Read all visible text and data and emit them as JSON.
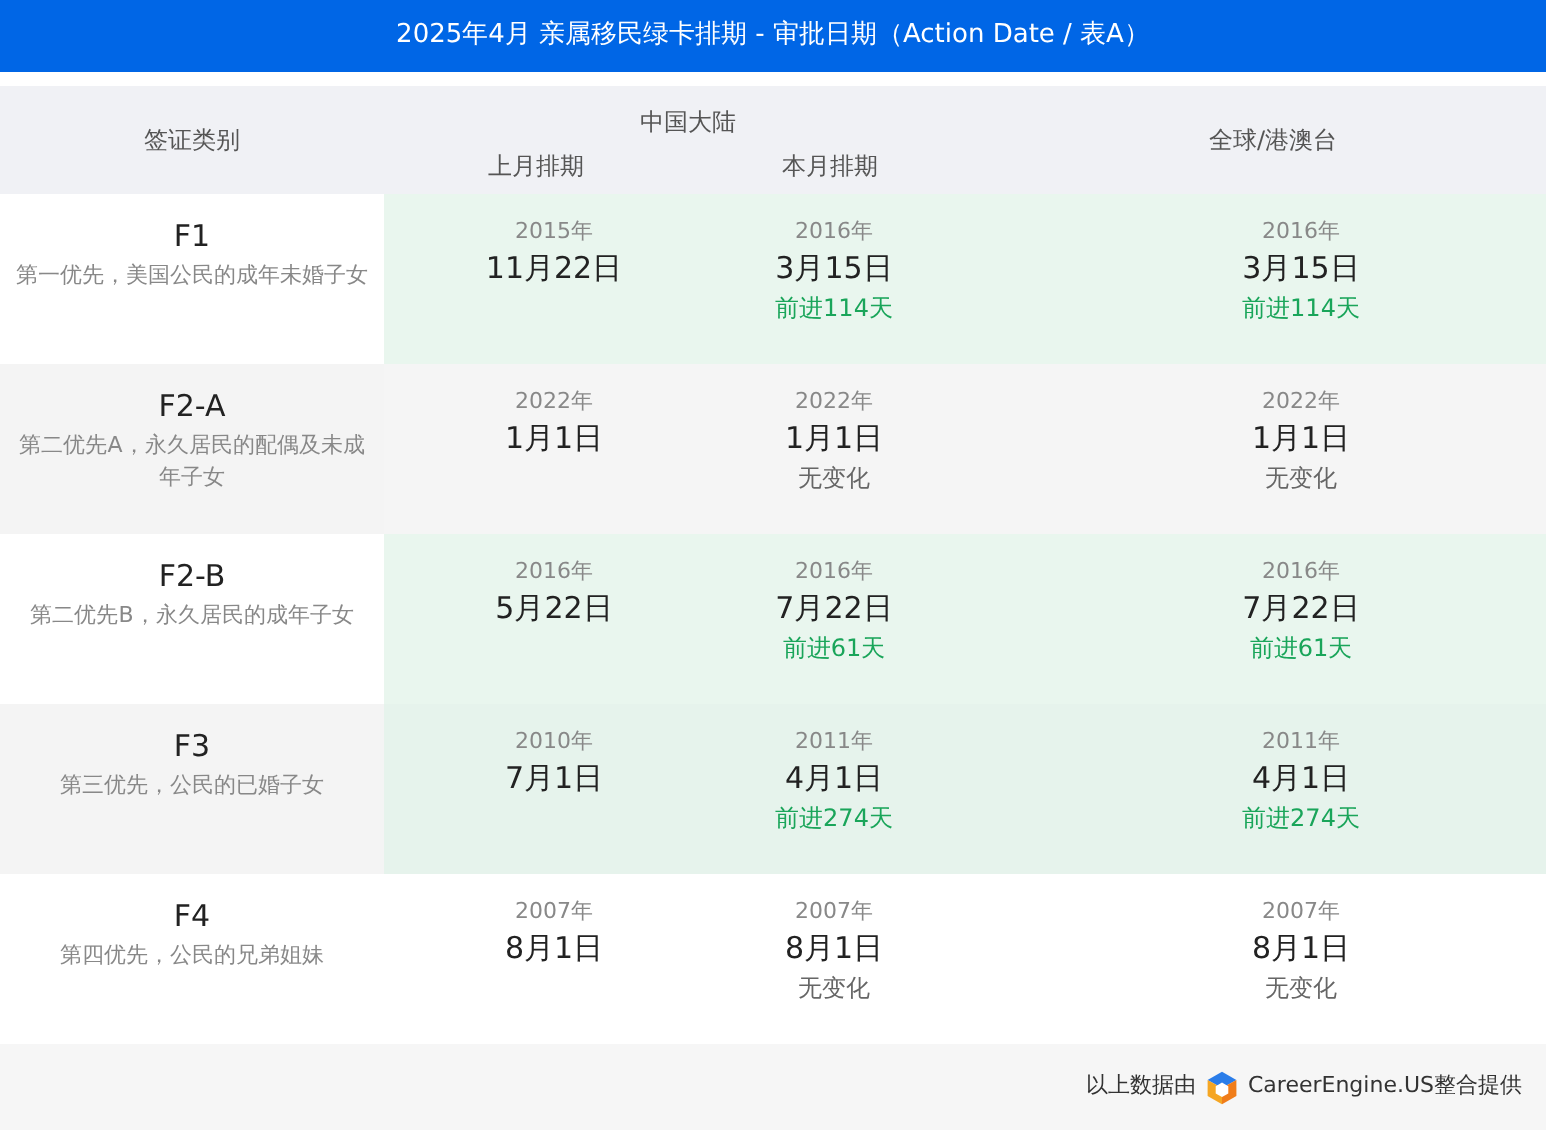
{
  "title": "2025年4月 亲属移民绿卡排期 - 审批日期（Action Date / 表A）",
  "header": {
    "category": "签证类别",
    "china_group": "中国大陆",
    "china_last": "上月排期",
    "china_this": "本月排期",
    "global": "全球/港澳台"
  },
  "rows": [
    {
      "code": "F1",
      "desc": "第一优先，美国公民的成年未婚子女",
      "advanced": true,
      "cn_last": {
        "year": "2015年",
        "date": "11月22日"
      },
      "cn_this": {
        "year": "2016年",
        "date": "3月15日",
        "change": "前进114天"
      },
      "global": {
        "year": "2016年",
        "date": "3月15日",
        "change": "前进114天"
      }
    },
    {
      "code": "F2-A",
      "desc": "第二优先A，永久居民的配偶及未成年子女",
      "advanced": false,
      "cn_last": {
        "year": "2022年",
        "date": "1月1日"
      },
      "cn_this": {
        "year": "2022年",
        "date": "1月1日",
        "change": "无变化"
      },
      "global": {
        "year": "2022年",
        "date": "1月1日",
        "change": "无变化"
      }
    },
    {
      "code": "F2-B",
      "desc": "第二优先B，永久居民的成年子女",
      "advanced": true,
      "cn_last": {
        "year": "2016年",
        "date": "5月22日"
      },
      "cn_this": {
        "year": "2016年",
        "date": "7月22日",
        "change": "前进61天"
      },
      "global": {
        "year": "2016年",
        "date": "7月22日",
        "change": "前进61天"
      }
    },
    {
      "code": "F3",
      "desc": "第三优先，公民的已婚子女",
      "advanced": true,
      "cn_last": {
        "year": "2010年",
        "date": "7月1日"
      },
      "cn_this": {
        "year": "2011年",
        "date": "4月1日",
        "change": "前进274天"
      },
      "global": {
        "year": "2011年",
        "date": "4月1日",
        "change": "前进274天"
      }
    },
    {
      "code": "F4",
      "desc": "第四优先，公民的兄弟姐妹",
      "advanced": false,
      "cn_last": {
        "year": "2007年",
        "date": "8月1日"
      },
      "cn_this": {
        "year": "2007年",
        "date": "8月1日",
        "change": "无变化"
      },
      "global": {
        "year": "2007年",
        "date": "8月1日",
        "change": "无变化"
      }
    }
  ],
  "footer": {
    "prefix": "以上数据由",
    "brand": "CareerEngine.US整合提供"
  }
}
